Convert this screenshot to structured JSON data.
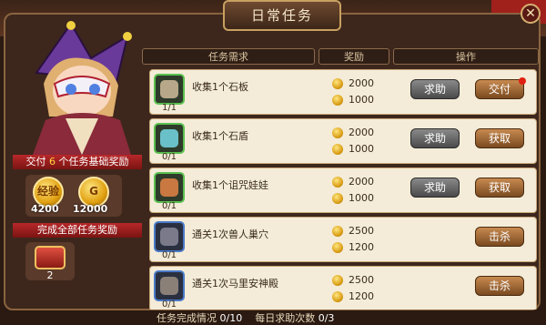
{
  "title": "日常任务",
  "columns": {
    "task": "任务需求",
    "reward": "奖励",
    "action": "操作"
  },
  "daily_reward": {
    "prefix": "交付",
    "count": "6",
    "suffix": "个任务基础奖励"
  },
  "rewards": [
    {
      "icon": "exp-coin-icon",
      "glyph": "经验",
      "amount": "4200"
    },
    {
      "icon": "gold-coin-icon",
      "glyph": "G",
      "amount": "12000"
    }
  ],
  "all_complete": {
    "label": "完成全部任务奖励",
    "chest_count": "2"
  },
  "tasks": [
    {
      "name": "收集1个石板",
      "progress": "1/1",
      "exp": "2000",
      "gold": "1000",
      "help": "求助",
      "action": "交付",
      "notify": true,
      "item_color": "#b8a88a",
      "frame": "green"
    },
    {
      "name": "收集1个石盾",
      "progress": "0/1",
      "exp": "2000",
      "gold": "1000",
      "help": "求助",
      "action": "获取",
      "notify": false,
      "item_color": "#6ac0c8",
      "frame": "green"
    },
    {
      "name": "收集1个诅咒娃娃",
      "progress": "0/1",
      "exp": "2000",
      "gold": "1000",
      "help": "求助",
      "action": "获取",
      "notify": false,
      "item_color": "#c87840",
      "frame": "green"
    },
    {
      "name": "通关1次兽人巢穴",
      "progress": "0/1",
      "exp": "2500",
      "gold": "1200",
      "help": "",
      "action": "击杀",
      "notify": false,
      "item_color": "#7a7a8a",
      "frame": "blue"
    },
    {
      "name": "通关1次马里安神殿",
      "progress": "0/1",
      "exp": "2500",
      "gold": "1200",
      "help": "",
      "action": "击杀",
      "notify": false,
      "item_color": "#8a8078",
      "frame": "blue"
    }
  ],
  "footer": {
    "complete_label": "任务完成情况",
    "complete_value": "0/10",
    "help_label": "每日求助次数",
    "help_value": "0/3"
  },
  "colors": {
    "accent_red": "#b8282a",
    "gold": "#e0a010",
    "panel": "#3d271c"
  }
}
